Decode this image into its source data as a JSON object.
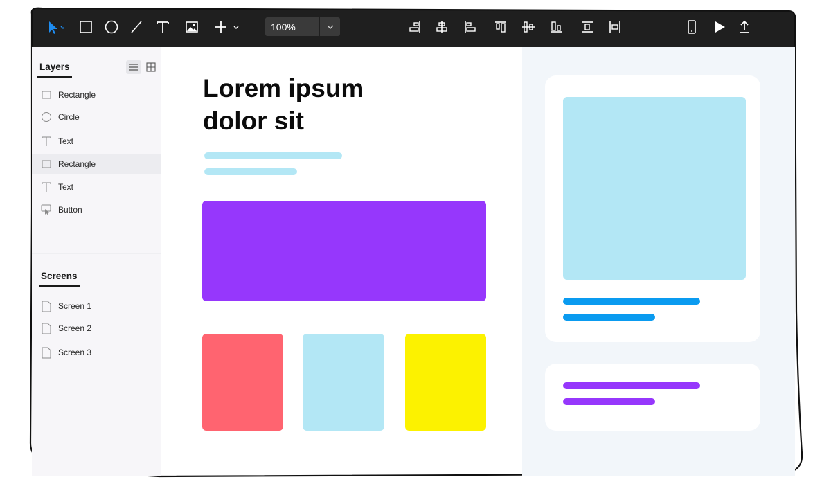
{
  "toolbar": {
    "tools": [
      {
        "name": "select-tool",
        "icon": "cursor-arrow-icon"
      },
      {
        "name": "rectangle-tool",
        "icon": "rectangle-icon"
      },
      {
        "name": "ellipse-tool",
        "icon": "circle-icon"
      },
      {
        "name": "line-tool",
        "icon": "line-icon"
      },
      {
        "name": "text-tool",
        "icon": "text-icon"
      },
      {
        "name": "image-tool",
        "icon": "image-icon"
      },
      {
        "name": "add-tool",
        "icon": "plus-icon"
      }
    ],
    "zoom": "100%",
    "align_tools": [
      "align-right-icon",
      "align-center-horizontal-icon",
      "align-left-icon",
      "align-top-icon",
      "align-middle-icon",
      "align-bottom-icon",
      "distribute-vertical-icon",
      "distribute-horizontal-icon"
    ],
    "right_tools": [
      "mobile-preview-icon",
      "play-icon",
      "export-icon"
    ]
  },
  "layers_panel": {
    "title": "Layers",
    "items": [
      {
        "label": "Rectangle",
        "icon": "rectangle-icon",
        "selected": false
      },
      {
        "label": "Circle",
        "icon": "circle-icon",
        "selected": false
      },
      {
        "label": "Text",
        "icon": "text-icon",
        "selected": false
      },
      {
        "label": "Rectangle",
        "icon": "rectangle-icon",
        "selected": true
      },
      {
        "label": "Text",
        "icon": "text-icon",
        "selected": false
      },
      {
        "label": "Button",
        "icon": "button-icon",
        "selected": false
      }
    ]
  },
  "screens_panel": {
    "title": "Screens",
    "items": [
      {
        "label": "Screen 1",
        "icon": "page-icon"
      },
      {
        "label": "Screen 2",
        "icon": "page-icon"
      },
      {
        "label": "Screen 3",
        "icon": "page-icon"
      }
    ]
  },
  "canvas": {
    "heading": "Lorem ipsum dolor sit"
  },
  "colors": {
    "toolbar_bg": "#1f1f1f",
    "accent_blue": "#1e8cf0",
    "purple": "#9637fc",
    "light_blue": "#b3e7f5",
    "coral": "#ff6470",
    "yellow": "#fcf200",
    "bright_blue": "#0a9bf0",
    "right_panel_bg": "#f2f6fa"
  }
}
